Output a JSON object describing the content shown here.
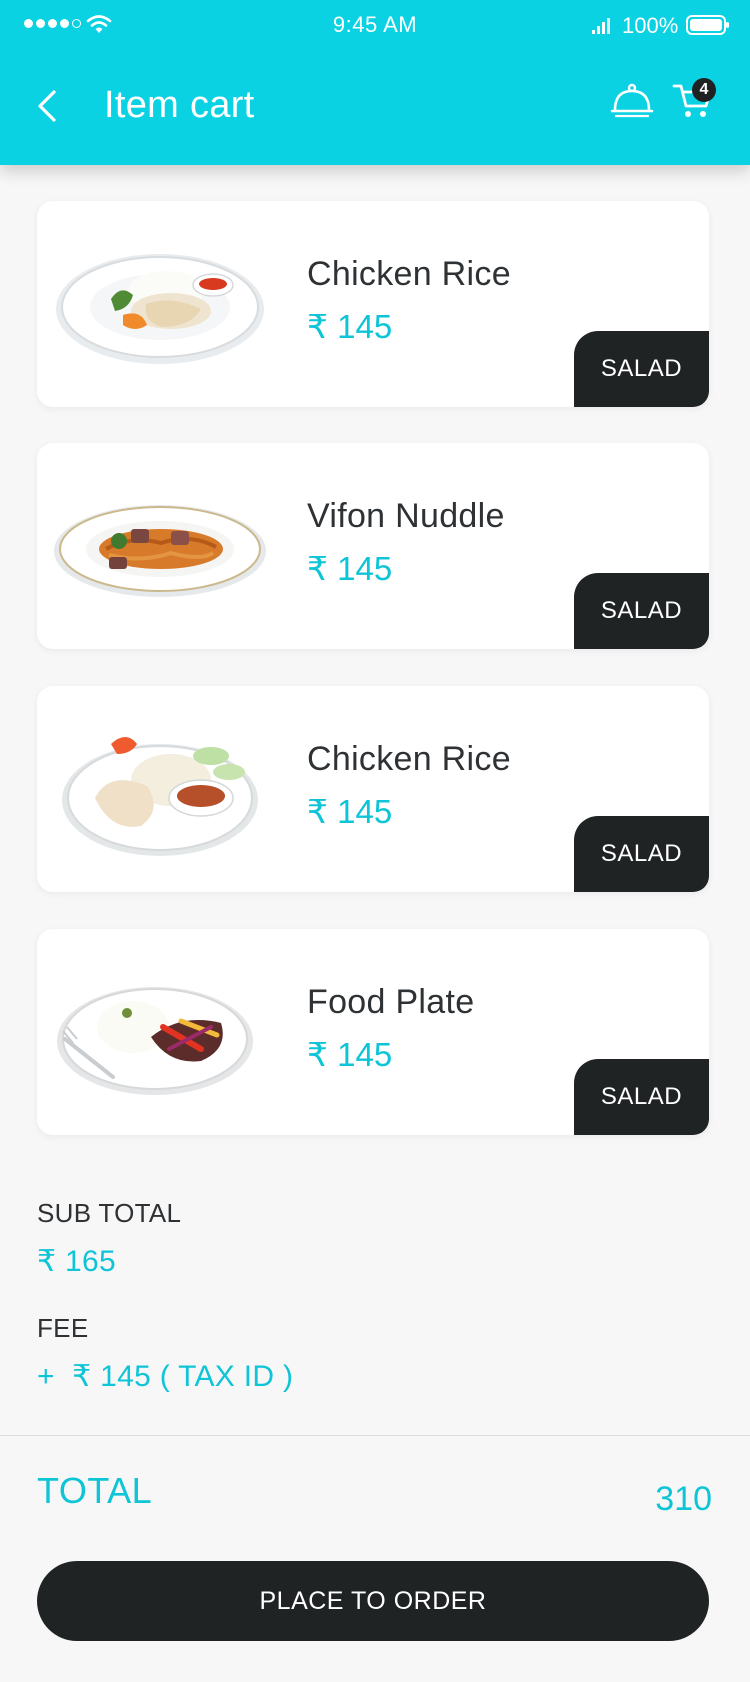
{
  "status_bar": {
    "time": "9:45 AM",
    "battery": "100%"
  },
  "header": {
    "title": "Item cart",
    "cart_count": "4",
    "icons": [
      "back-icon",
      "food-dish-icon",
      "cart-icon"
    ]
  },
  "items": [
    {
      "name": "Chicken Rice",
      "price": "₹ 145",
      "tag": "SALAD"
    },
    {
      "name": "Vifon Nuddle",
      "price": "₹ 145",
      "tag": "SALAD"
    },
    {
      "name": "Chicken Rice",
      "price": "₹ 145",
      "tag": "SALAD"
    },
    {
      "name": "Food Plate",
      "price": "₹ 145",
      "tag": "SALAD"
    }
  ],
  "summary": {
    "subtotal_label": "SUB TOTAL",
    "subtotal_value": "₹ 165",
    "fee_label": "FEE",
    "fee_value": "+  ₹ 145 ( TAX ID )",
    "total_label": "TOTAL",
    "total_value": "310"
  },
  "order_button": {
    "label": "PLACE TO ORDER"
  },
  "colors": {
    "accent": "#0ad2e2",
    "price_text": "#0ec4d7",
    "dark": "#1f2324",
    "background": "#f8f7f8"
  }
}
